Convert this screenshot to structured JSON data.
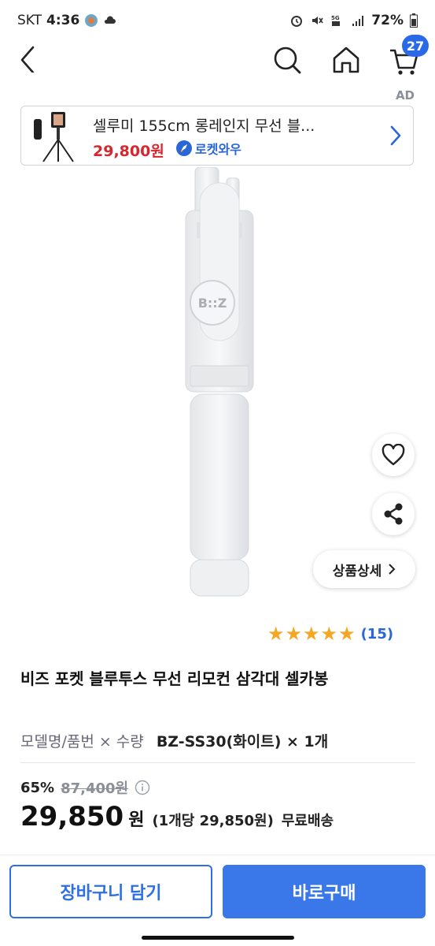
{
  "status_bar": {
    "carrier": "SKT",
    "time": "4:36",
    "battery": "72%"
  },
  "nav": {
    "cart_count": "27"
  },
  "ad": {
    "label": "AD",
    "title": "셀루미 155cm 롱레인지 무선 블...",
    "price": "29,800원",
    "badge": "로켓와우"
  },
  "product": {
    "logo_text": "B::Z",
    "detail_label": "상품상세",
    "rating_count": "(15)",
    "title": "비즈 포켓 블루투스 무선 리모컨 삼각대 셀카봉",
    "option_label": "모델명/품번 × 수량",
    "option_value": "BZ-SS30(화이트) × 1개",
    "discount": "65%",
    "original_price": "87,400원",
    "price": "29,850",
    "price_unit": "원",
    "unit_price": "(1개당 29,850원)",
    "shipping": "무료배송"
  },
  "actions": {
    "cart_label": "장바구니 담기",
    "buy_label": "바로구매"
  },
  "colors": {
    "accent": "#2f6fe4",
    "sale_red": "#d8262f",
    "star": "#f5a623"
  },
  "rating_stars": 5
}
